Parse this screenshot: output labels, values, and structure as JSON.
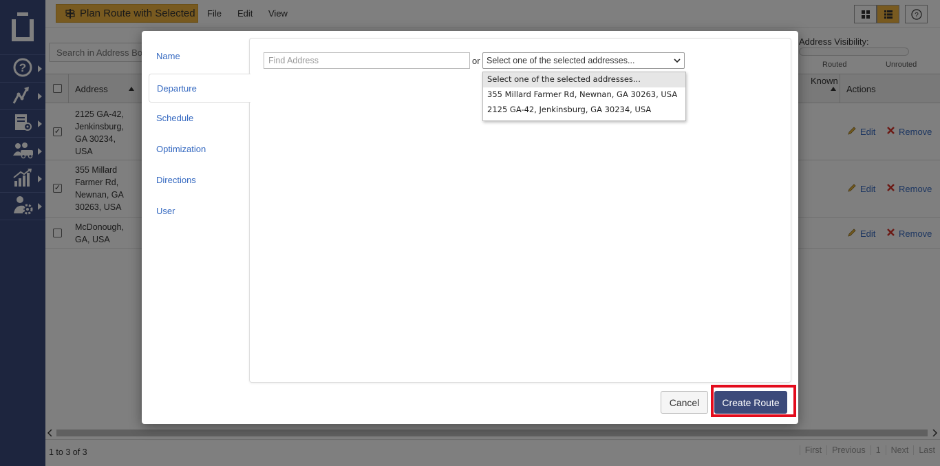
{
  "toolbar": {
    "plan_route_label": "Plan Route with Selected",
    "menu": [
      "File",
      "Edit",
      "View"
    ]
  },
  "search": {
    "placeholder": "Search in Address Book"
  },
  "visibility": {
    "label": "Address Visibility:",
    "routed": "Routed",
    "unrouted": "Unrouted"
  },
  "table": {
    "headers": {
      "address": "Address",
      "known": "Known",
      "actions": "Actions"
    },
    "rows": [
      {
        "address": [
          "2125 GA-42,",
          "Jenkinsburg,",
          "GA 30234,",
          "USA"
        ],
        "checked": true,
        "edit": "Edit",
        "remove": "Remove"
      },
      {
        "address": [
          "355 Millard",
          "Farmer Rd,",
          "Newnan, GA",
          "30263, USA"
        ],
        "checked": true,
        "edit": "Edit",
        "remove": "Remove"
      },
      {
        "address": [
          "McDonough,",
          "GA, USA"
        ],
        "checked": false,
        "edit": "Edit",
        "remove": "Remove"
      }
    ]
  },
  "footer": {
    "count": "1 to 3 of 3",
    "pager": [
      "First",
      "Previous",
      "1",
      "Next",
      "Last"
    ]
  },
  "modal": {
    "tabs": [
      "Name",
      "Departure",
      "Schedule",
      "Optimization",
      "Directions",
      "User"
    ],
    "active_tab": "Departure",
    "find_placeholder": "Find Address",
    "or_text": "or",
    "select_value": "Select one of the selected addresses...",
    "options": [
      "Select one of the selected addresses...",
      "355 Millard Farmer Rd, Newnan, GA 30263, USA",
      "2125 GA-42, Jenkinsburg, GA 30234, USA"
    ],
    "cancel_label": "Cancel",
    "create_label": "Create Route"
  },
  "colors": {
    "sidebar": "#3b4b7c",
    "plan_button": "#f0b441",
    "link": "#3468c0",
    "primary_button": "#3c4a7a",
    "highlight": "#e30b1c",
    "remove_icon": "#d9342b"
  },
  "icons": {
    "sidebar": [
      "logo-icon",
      "help-icon",
      "routes-icon",
      "address-book-icon",
      "team-icon",
      "analytics-icon",
      "user-settings-icon"
    ],
    "toolbar": [
      "signpost-icon",
      "grid-view-icon",
      "list-view-icon",
      "help-icon"
    ]
  }
}
